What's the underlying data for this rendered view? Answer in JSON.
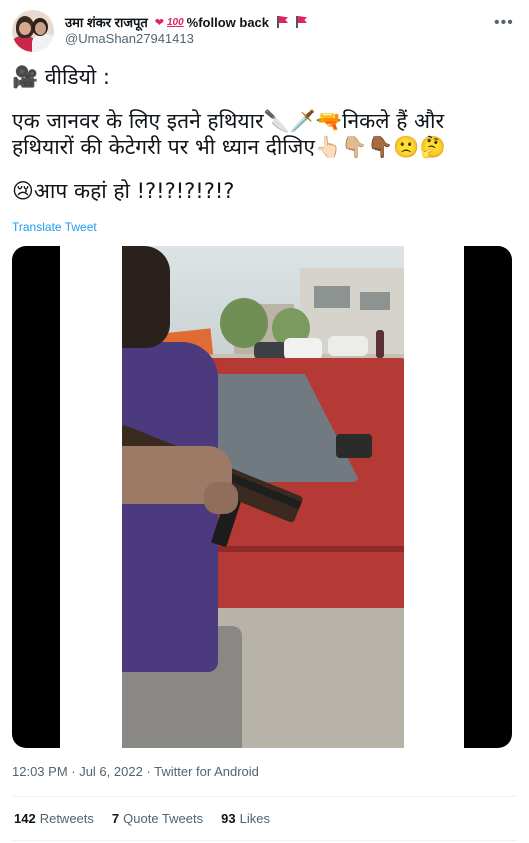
{
  "author": {
    "display_name": "उमा शंकर राजपूत",
    "follow_back_text": "%follow back",
    "handle": "@UmaShan27941413",
    "name_emojis": [
      "heart-icon",
      "hundred-icon"
    ],
    "flag_icons": [
      "flag-icon",
      "flag-icon"
    ]
  },
  "tweet": {
    "line1": "🎥 वीडियो :",
    "line2": "एक जानवर के लिए इतने हथियार🔪🗡️🔫निकले हैं और",
    "line3": "हथियारों की केटेगरी पर भी ध्यान दीजिए👆🏻👇🏼👇🏾🙁🤔",
    "line4": "😢आप कहां हो !?!?!?!?!?",
    "translate_label": "Translate Tweet"
  },
  "media": {
    "type": "video"
  },
  "meta": {
    "time": "12:03 PM",
    "date": "Jul 6, 2022",
    "separator": "·",
    "source": "Twitter for Android",
    "timestamp_full": "12:03 PM · Jul 6, 2022 · Twitter for Android"
  },
  "stats": {
    "retweets_count": "142",
    "retweets_label": "Retweets",
    "quotes_count": "7",
    "quotes_label": "Quote Tweets",
    "likes_count": "93",
    "likes_label": "Likes"
  },
  "colors": {
    "link": "#1d9bf0",
    "text": "#0f1419",
    "secondary": "#536471",
    "flag": "#e0245e"
  }
}
